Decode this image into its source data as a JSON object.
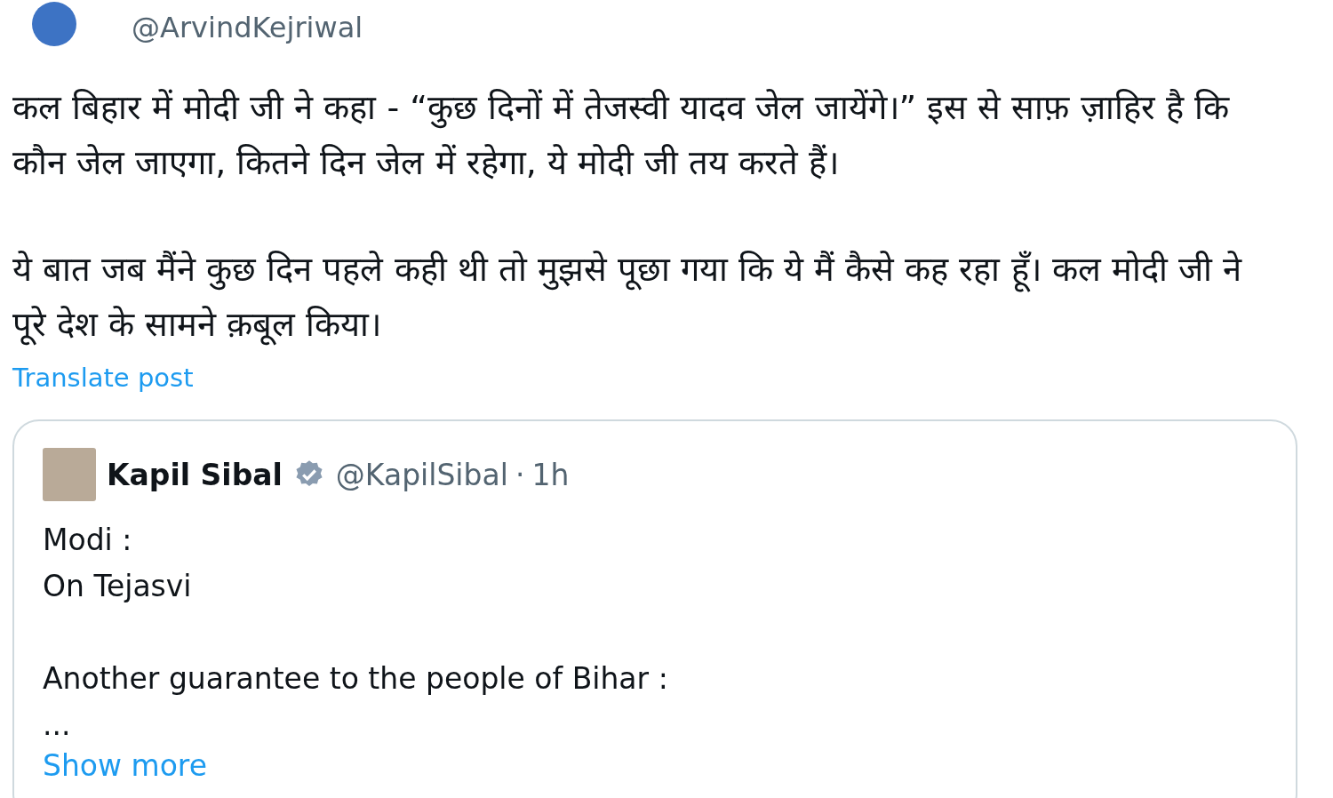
{
  "author": {
    "handle": "@ArvindKejriwal"
  },
  "body": {
    "paragraphs": [
      "कल बिहार में मोदी जी ने कहा - “कुछ दिनों में तेजस्वी यादव जेल जायेंगे।” इस से साफ़ ज़ाहिर है कि कौन जेल जाएगा, कितने दिन जेल में रहेगा, ये मोदी जी तय करते हैं।",
      "ये बात जब मैंने कुछ दिन पहले कही थी तो मुझसे पूछा गया कि ये मैं कैसे कह रहा हूँ। कल मोदी जी ने पूरे देश के सामने क़बूल किया।"
    ]
  },
  "translate_link": "Translate post",
  "quoted_post": {
    "name": "Kapil Sibal",
    "verified": true,
    "handle": "@KapilSibal",
    "separator": "·",
    "time": "1h",
    "paragraphs": [
      "Modi :\nOn Tejasvi",
      "Another guarantee to the people of Bihar :\n..."
    ],
    "show_more": "Show more"
  }
}
